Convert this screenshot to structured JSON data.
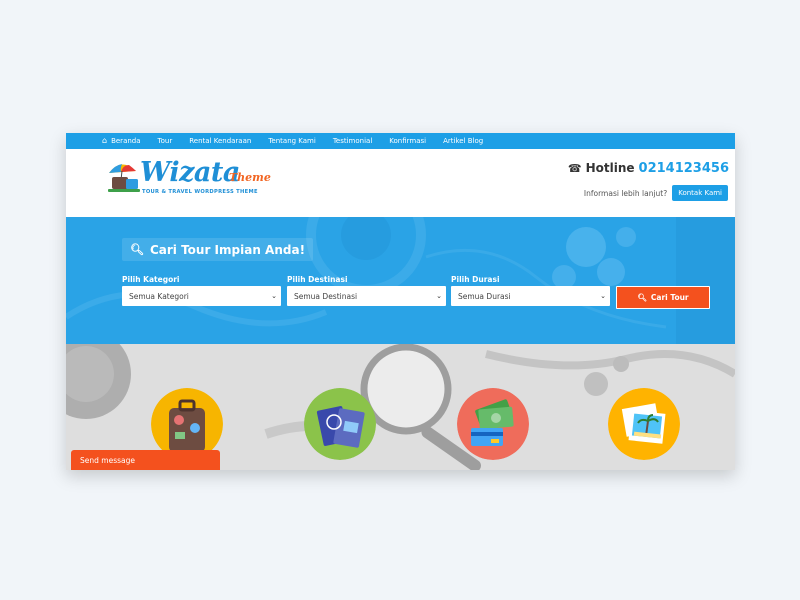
{
  "nav": {
    "items": [
      {
        "label": "Beranda",
        "icon": "home-icon"
      },
      {
        "label": "Tour"
      },
      {
        "label": "Rental Kendaraan"
      },
      {
        "label": "Tentang Kami"
      },
      {
        "label": "Testimonial"
      },
      {
        "label": "Konfirmasi"
      },
      {
        "label": "Artikel Blog"
      }
    ]
  },
  "header": {
    "logo_main": "Wizata",
    "logo_sub": "Theme",
    "logo_tagline": "TOUR & TRAVEL WORDPRESS THEME",
    "hotline_label": "Hotline",
    "hotline_number": "0214123456",
    "info_text": "Informasi lebih lanjut?",
    "contact_button": "Kontak Kami"
  },
  "search": {
    "title": "Cari Tour Impian Anda!",
    "fields": [
      {
        "label": "Pilih Kategori",
        "value": "Semua Kategori"
      },
      {
        "label": "Pilih Destinasi",
        "value": "Semua Destinasi"
      },
      {
        "label": "Pilih Durasi",
        "value": "Semua Durasi"
      }
    ],
    "button": "Cari Tour"
  },
  "features": {
    "icons": [
      "suitcase-icon",
      "passport-icon",
      "money-icon",
      "photo-icon"
    ]
  },
  "chat": {
    "label": "Send message"
  },
  "colors": {
    "brand_blue": "#1d9fe6",
    "accent_orange": "#f4511e",
    "hero_blue": "#2aa3e6"
  }
}
